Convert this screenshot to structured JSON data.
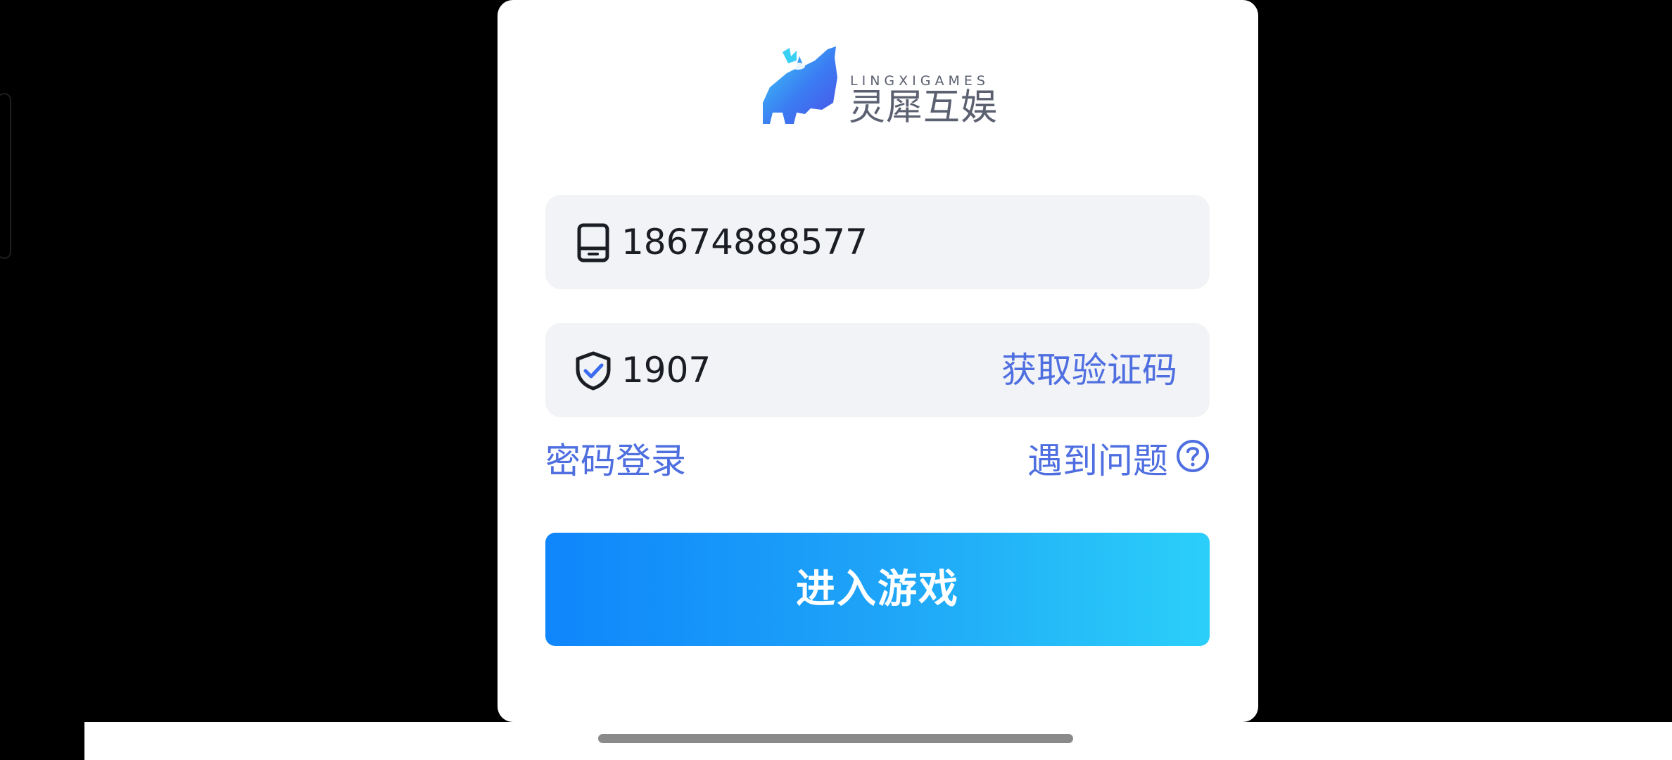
{
  "brand": {
    "name_en": "LINGXIGAMES",
    "name_cn": "灵犀互娱"
  },
  "login": {
    "phone_value": "18674888577",
    "code_value": "1907",
    "get_code_label": "获取验证码",
    "password_login_label": "密码登录",
    "problem_label": "遇到问题",
    "enter_label": "进入游戏"
  },
  "colors": {
    "accent": "#4f6fe0",
    "button_gradient_start": "#0f86fb",
    "button_gradient_end": "#2bcff9",
    "field_background": "#f2f3f6"
  },
  "icons": {
    "phone": "phone-icon",
    "code": "shield-check-icon",
    "help": "question-circle-icon",
    "logo": "rhino-logo-icon"
  }
}
